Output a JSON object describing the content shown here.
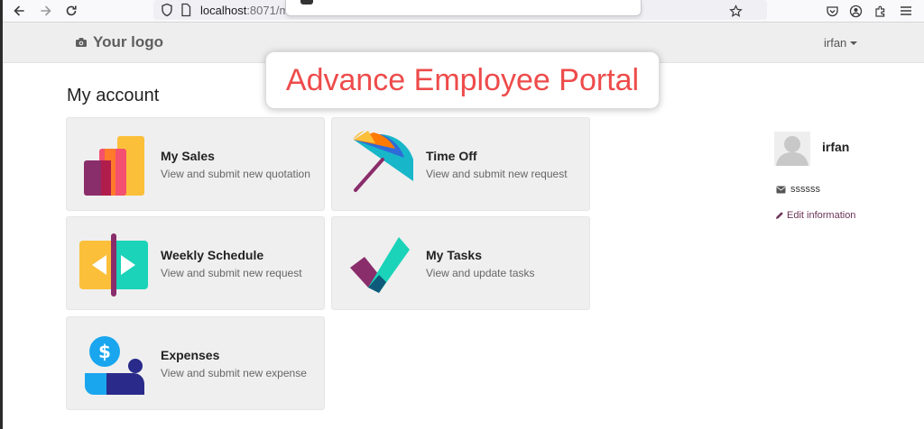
{
  "browser": {
    "url_host": "localhost",
    "url_rest": ":8071/m",
    "icons": [
      "back-arrow-icon",
      "forward-arrow-icon",
      "reload-icon",
      "shield-icon",
      "page-icon",
      "bookmark-star-icon",
      "pocket-icon",
      "account-icon",
      "extensions-icon",
      "menu-icon"
    ]
  },
  "header": {
    "logo_text": "Your logo",
    "user_name": "irfan"
  },
  "banner": {
    "text": "Advance Employee Portal"
  },
  "page": {
    "title": "My account"
  },
  "cards": [
    {
      "title": "My Sales",
      "subtitle": "View and submit new quotation",
      "icon": "sales-bars-icon"
    },
    {
      "title": "Time Off",
      "subtitle": "View and submit new request",
      "icon": "umbrella-icon"
    },
    {
      "title": "Weekly Schedule",
      "subtitle": "View and submit new request",
      "icon": "schedule-arrows-icon"
    },
    {
      "title": "My Tasks",
      "subtitle": "View and update tasks",
      "icon": "checkmark-icon"
    },
    {
      "title": "Expenses",
      "subtitle": "View and submit new expense",
      "icon": "dollar-coin-icon"
    }
  ],
  "sidebar": {
    "name": "irfan",
    "email": "ssssss",
    "edit_label": "Edit information"
  },
  "colors": {
    "header_bg": "#eeeeee",
    "card_bg": "#efefef",
    "banner_text": "#ee4b4b",
    "link": "#6b3457"
  }
}
